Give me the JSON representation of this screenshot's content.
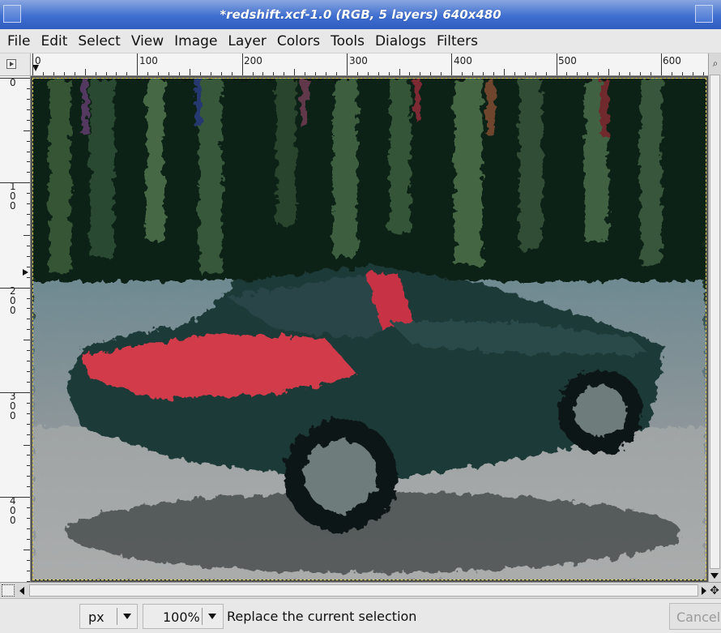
{
  "window": {
    "title": "*redshift.xcf-1.0 (RGB, 5 layers) 640x480"
  },
  "menu": [
    "File",
    "Edit",
    "Select",
    "View",
    "Image",
    "Layer",
    "Colors",
    "Tools",
    "Dialogs",
    "Filters"
  ],
  "rulers": {
    "horizontal_labels": [
      "0",
      "100",
      "200",
      "300",
      "400",
      "500",
      "600"
    ],
    "vertical_labels": [
      "0",
      "100",
      "200",
      "300",
      "400"
    ]
  },
  "statusbar": {
    "unit": "px",
    "zoom": "100%",
    "message": "Replace the current selection",
    "cancel_label": "Cancel"
  },
  "colors": {
    "title_blue": "#3f6fd0",
    "selection_dash": "#e0d050",
    "car_red": "#d23a4a",
    "car_dark": "#1f3a38"
  },
  "icons": [
    "menu-corner-icon",
    "zoom-icon",
    "quick-mask-icon",
    "navigate-icon"
  ]
}
